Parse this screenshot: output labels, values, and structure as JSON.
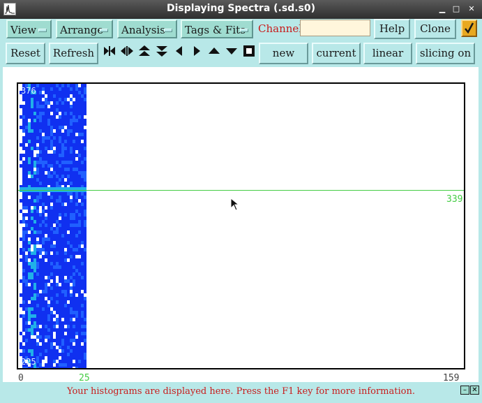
{
  "window": {
    "title": "Displaying Spectra (.sd.s0)"
  },
  "menus": [
    {
      "label": "View"
    },
    {
      "label": "Arrange"
    },
    {
      "label": "Analysis"
    },
    {
      "label": "Tags & Fits"
    }
  ],
  "channel": {
    "label": "Channel:",
    "value": ""
  },
  "buttons": {
    "help": "Help",
    "clone": "Clone",
    "reset": "Reset",
    "refresh": "Refresh",
    "new": "new",
    "current": "current",
    "linear": "linear",
    "slicing": "slicing on"
  },
  "nav_icons": [
    "fit-horizontal-icon",
    "expand-horizontal-icon",
    "expand-up-icon",
    "expand-down-icon",
    "pan-left-icon",
    "pan-right-icon",
    "pan-up-icon",
    "pan-down-icon",
    "full-view-icon"
  ],
  "plot": {
    "y_top_label": "376",
    "y_bottom_label": "225",
    "slice_value": "339",
    "x_ticks": [
      "0",
      "25",
      "159"
    ],
    "colors": {
      "heat_dark": "#1030f0",
      "heat_mid": "#2060ff",
      "heat_light": "#20b0e8",
      "slice": "#44cc44"
    }
  },
  "status": {
    "message": "Your histograms are displayed here. Press the F1 key for more information."
  }
}
